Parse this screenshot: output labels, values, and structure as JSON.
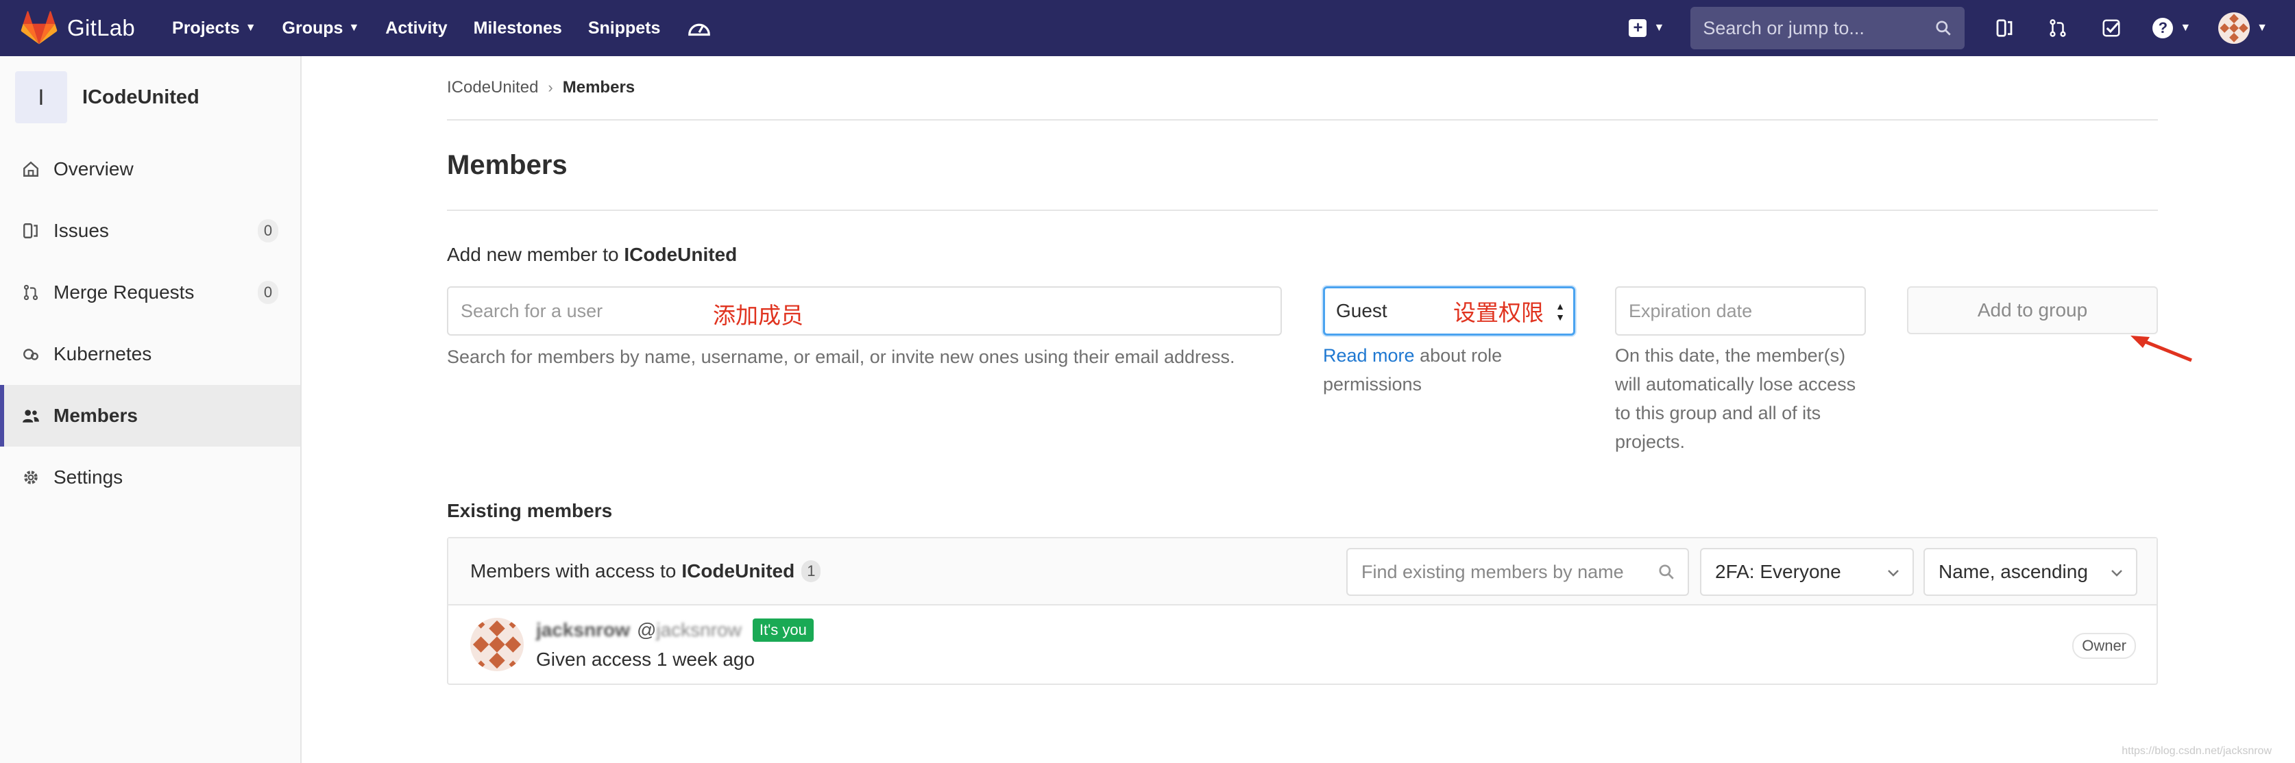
{
  "navbar": {
    "brand": "GitLab",
    "links": [
      {
        "label": "Projects",
        "has_caret": true
      },
      {
        "label": "Groups",
        "has_caret": true
      },
      {
        "label": "Activity",
        "has_caret": false
      },
      {
        "label": "Milestones",
        "has_caret": false
      },
      {
        "label": "Snippets",
        "has_caret": false
      }
    ],
    "search_placeholder": "Search or jump to...",
    "bg_color": "#292961"
  },
  "sidebar": {
    "group_initial": "I",
    "group_name": "ICodeUnited",
    "items": [
      {
        "label": "Overview",
        "icon": "home-icon"
      },
      {
        "label": "Issues",
        "icon": "issues-icon",
        "count": "0"
      },
      {
        "label": "Merge Requests",
        "icon": "merge-request-icon",
        "count": "0"
      },
      {
        "label": "Kubernetes",
        "icon": "kubernetes-icon"
      },
      {
        "label": "Members",
        "icon": "users-icon",
        "active": true
      },
      {
        "label": "Settings",
        "icon": "settings-icon"
      }
    ]
  },
  "breadcrumb": {
    "group": "ICodeUnited",
    "current": "Members"
  },
  "page": {
    "title": "Members"
  },
  "add_member": {
    "heading_prefix": "Add new member to",
    "heading_group": "ICodeUnited",
    "search_placeholder": "Search for a user",
    "search_annotation": "添加成员",
    "search_help": "Search for members by name, username, or email, or invite new ones using their email address.",
    "role_value": "Guest",
    "role_annotation": "设置权限",
    "role_help_link": "Read more",
    "role_help_text": "about role permissions",
    "expiration_placeholder": "Expiration date",
    "expiration_help": "On this date, the member(s) will automatically lose access to this group and all of its projects.",
    "submit_label": "Add to group"
  },
  "existing": {
    "title": "Existing members",
    "panel_prefix": "Members with access to",
    "panel_group": "ICodeUnited",
    "count": "1",
    "find_placeholder": "Find existing members by name",
    "filter_2fa": "2FA: Everyone",
    "sort": "Name, ascending",
    "members": [
      {
        "name": "jacksnrow",
        "username_prefix": "@",
        "username": "jacksnrow",
        "badge": "It's you",
        "access": "Given access 1 week ago",
        "role": "Owner"
      }
    ]
  },
  "watermark": "https://blog.csdn.net/jacksnrow"
}
